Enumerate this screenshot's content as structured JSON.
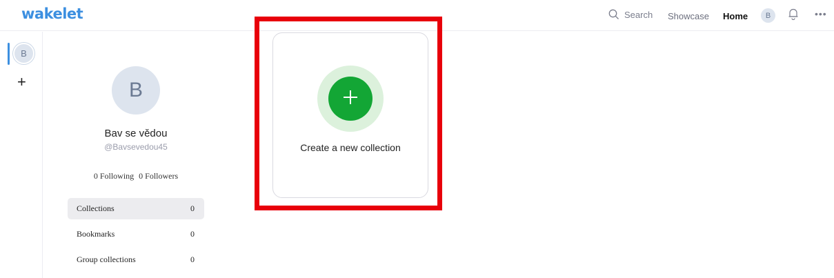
{
  "header": {
    "logo": "wakelet",
    "search_label": "Search",
    "showcase_label": "Showcase",
    "home_label": "Home",
    "avatar_initial": "B",
    "more_label": "•••"
  },
  "rail": {
    "avatar_initial": "B",
    "add_label": "+"
  },
  "profile": {
    "avatar_initial": "B",
    "name": "Bav se vědou",
    "handle": "@Bavsevedou45",
    "following": "0 Following",
    "followers": "0 Followers"
  },
  "side_nav": {
    "items": [
      {
        "label": "Collections",
        "count": "0",
        "active": true
      },
      {
        "label": "Bookmarks",
        "count": "0",
        "active": false
      },
      {
        "label": "Group collections",
        "count": "0",
        "active": false
      }
    ]
  },
  "create_card": {
    "label": "Create a new collection"
  },
  "colors": {
    "brand_blue": "#3c8fe0",
    "create_green": "#13a635",
    "create_halo": "#dcf1dc",
    "highlight_red": "#e8000b"
  },
  "icons": [
    "search-icon",
    "bell-icon",
    "more-icon",
    "plus-icon"
  ]
}
